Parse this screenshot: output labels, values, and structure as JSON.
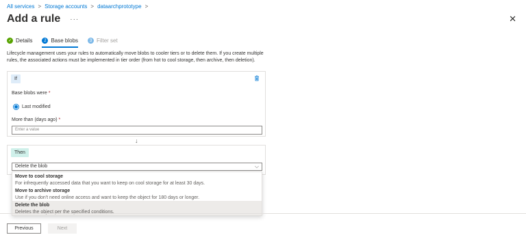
{
  "breadcrumb": {
    "items": [
      "All services",
      "Storage accounts",
      "dataarchprototype"
    ]
  },
  "header": {
    "title": "Add a rule",
    "more": "···",
    "close": "✕"
  },
  "tabs": [
    {
      "label": "Details",
      "state": "done",
      "marker": "✓"
    },
    {
      "label": "Base blobs",
      "state": "active",
      "marker": "2"
    },
    {
      "label": "Filter set",
      "state": "pending",
      "marker": "3"
    }
  ],
  "description": "Lifecycle management uses your rules to automatically move blobs to cooler tiers or to delete them. If you create multiple rules, the associated actions must be implemented in tier order (from hot to cool storage, then archive, then deletion).",
  "if_card": {
    "pill": "If",
    "base_blobs_label": "Base blobs were",
    "radio_label": "Last modified",
    "days_label": "More than (days ago)",
    "days_placeholder": "Enter a value"
  },
  "then_card": {
    "pill": "Then",
    "select_value": "Delete the blob"
  },
  "dropdown": {
    "options": [
      {
        "title": "Move to cool storage",
        "desc": "For infrequently accessed data that you want to keep on cool storage for at least 30 days."
      },
      {
        "title": "Move to archive storage",
        "desc": "Use if you don't need online access and want to keep the object for 180 days or longer."
      },
      {
        "title": "Delete the blob",
        "desc": "Deletes the object per the specified conditions.",
        "selected": true
      }
    ]
  },
  "footer": {
    "previous": "Previous",
    "next": "Next"
  },
  "colors": {
    "accent": "#0078d4",
    "success": "#57a300",
    "required": "#a4262c"
  }
}
